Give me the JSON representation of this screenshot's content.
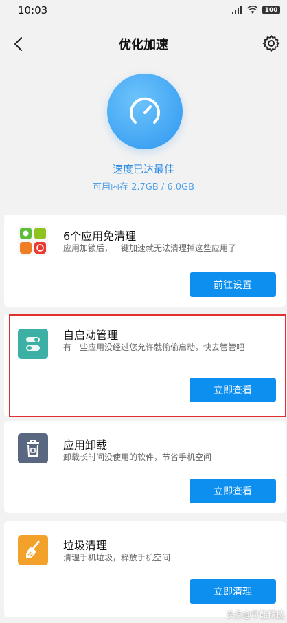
{
  "status_bar": {
    "time": "10:03",
    "battery": "100"
  },
  "header": {
    "title": "优化加速"
  },
  "hero": {
    "status": "速度已达最佳",
    "memory": "可用内存 2.7GB / 6.0GB"
  },
  "cards": [
    {
      "title": "6个应用免清理",
      "desc": "应用加锁后，一键加速就无法清理掉这些应用了",
      "button": "前往设置",
      "icon": "app-grid-icon"
    },
    {
      "title": "自启动管理",
      "desc": "有一些应用没经过您允许就偷偷启动，快去管管吧",
      "button": "立即查看",
      "icon": "toggle-icon"
    },
    {
      "title": "应用卸载",
      "desc": "卸载长时间没使用的软件，节省手机空间",
      "button": "立即查看",
      "icon": "uninstall-trash-icon"
    },
    {
      "title": "垃圾清理",
      "desc": "清理手机垃圾，释放手机空间",
      "button": "立即清理",
      "icon": "broom-icon"
    }
  ],
  "colors": {
    "accent": "#0d8ff0",
    "highlight": "#e03030"
  },
  "watermark": "头条@早能精技"
}
